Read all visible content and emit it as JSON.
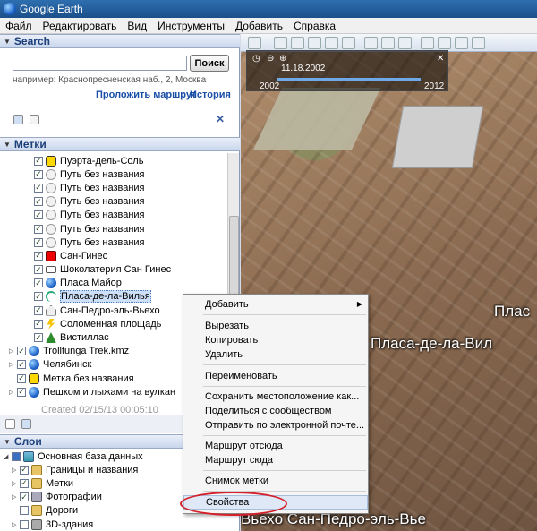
{
  "window": {
    "title": "Google Earth"
  },
  "menu": [
    "Файл",
    "Редактировать",
    "Вид",
    "Инструменты",
    "Добавить",
    "Справка"
  ],
  "search": {
    "header": "Search",
    "button": "Поиск",
    "hint": "например: Краснопресненская наб., 2, Москва",
    "route_link": "Проложить маршрут",
    "history_link": "История"
  },
  "places": {
    "header": "Метки",
    "items": [
      {
        "label": "Пуэрта-дель-Соль",
        "icon": "yellow-square-icon"
      },
      {
        "label": "Путь без названия",
        "icon": "path-icon"
      },
      {
        "label": "Путь без названия",
        "icon": "path-icon"
      },
      {
        "label": "Путь без названия",
        "icon": "path-icon"
      },
      {
        "label": "Путь без названия",
        "icon": "path-icon"
      },
      {
        "label": "Путь без названия",
        "icon": "path-icon"
      },
      {
        "label": "Путь без названия",
        "icon": "path-icon"
      },
      {
        "label": "Сан-Гинес",
        "icon": "red-x-icon"
      },
      {
        "label": "Шоколатерия Сан Гинес",
        "icon": "shop-icon"
      },
      {
        "label": "Пласа Майор",
        "icon": "globe-icon"
      },
      {
        "label": "Пласа-де-ла-Вилья",
        "icon": "pin-icon"
      },
      {
        "label": "Сан-Педро-эль-Вьехо",
        "icon": "home-icon"
      },
      {
        "label": "Соломенная площадь",
        "icon": "flash-icon"
      },
      {
        "label": "Вистиллас",
        "icon": "tree-icon"
      }
    ],
    "root_items": [
      {
        "label": "Trolltunga Trek.kmz",
        "icon": "globe-icon"
      },
      {
        "label": "Челябинск",
        "icon": "globe-icon"
      },
      {
        "label": "Метка без названия",
        "icon": "yellow-square-icon"
      },
      {
        "label": "Пешком и лыжами на вулкан",
        "icon": "globe-icon"
      }
    ],
    "created": "Created 02/15/13 00:05:10"
  },
  "layers": {
    "header": "Слои",
    "items": [
      {
        "label": "Основная база данных",
        "icon": "layer-icon"
      },
      {
        "label": "Границы и названия",
        "icon": "folder-icon"
      },
      {
        "label": "Метки",
        "icon": "folder-icon"
      },
      {
        "label": "Фотографии",
        "icon": "photo-icon"
      },
      {
        "label": "Дороги",
        "icon": "folder-icon"
      },
      {
        "label": "3D-здания",
        "icon": "3d-icon"
      }
    ]
  },
  "timeline": {
    "date": "11.18.2002",
    "start": "2002",
    "end": "2012"
  },
  "map_labels": {
    "right": "Плас",
    "middle": "Пласа-де-ла-Вил",
    "bottom": "Вьехо  Сан-Педро-эль-Вье"
  },
  "context_menu": {
    "add": "Добавить",
    "cut": "Вырезать",
    "copy": "Копировать",
    "delete": "Удалить",
    "rename": "Переименовать",
    "save_location": "Сохранить местоположение как...",
    "share": "Поделиться с сообществом",
    "email": "Отправить по электронной почте...",
    "route_from": "Маршрут отсюда",
    "route_to": "Маршрут сюда",
    "snapshot": "Снимок метки",
    "properties": "Свойства"
  }
}
